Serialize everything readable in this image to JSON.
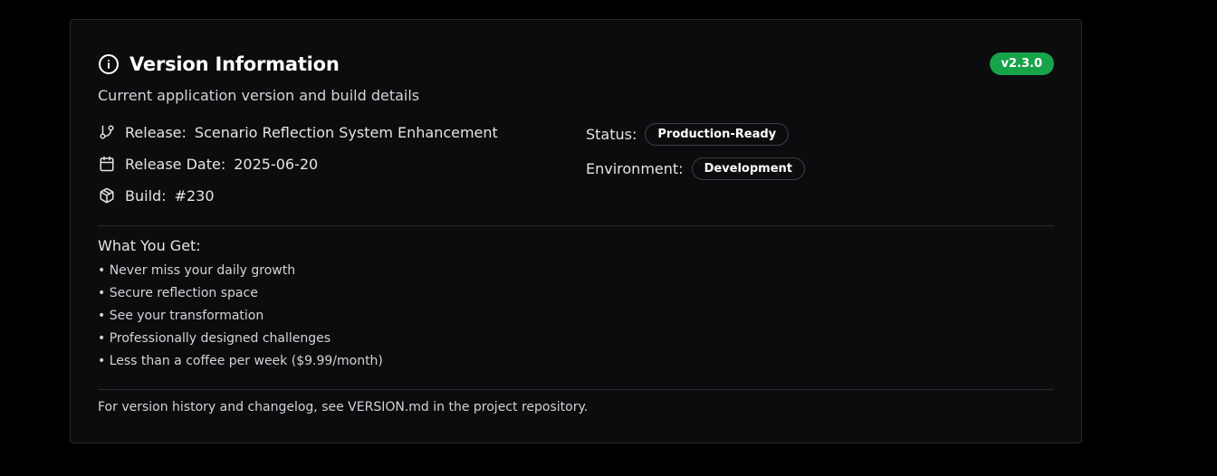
{
  "card": {
    "title": "Version Information",
    "title_icon": "info-icon",
    "version_badge": "v2.3.0",
    "subtitle": "Current application version and build details"
  },
  "meta": {
    "release": {
      "icon": "git-branch-icon",
      "label": "Release:",
      "value": "Scenario Reflection System Enhancement"
    },
    "release_date": {
      "icon": "calendar-icon",
      "label": "Release Date:",
      "value": "2025-06-20"
    },
    "build": {
      "icon": "package-icon",
      "label": "Build:",
      "value": "#230"
    }
  },
  "status": {
    "status_label": "Status:",
    "status_value": "Production-Ready",
    "environment_label": "Environment:",
    "environment_value": "Development"
  },
  "features": {
    "title": "What You Get:",
    "items": [
      "• Never miss your daily growth",
      "• Secure reflection space",
      "• See your transformation",
      "• Professionally designed challenges",
      "• Less than a coffee per week ($9.99/month)"
    ]
  },
  "footer": {
    "note": "For version history and changelog, see VERSION.md in the project repository."
  },
  "colors": {
    "background": "#000000",
    "card": "#0c0c0e",
    "border": "#2a2a2e",
    "badge_green": "#16a34a",
    "text": "#e4e4e7"
  }
}
